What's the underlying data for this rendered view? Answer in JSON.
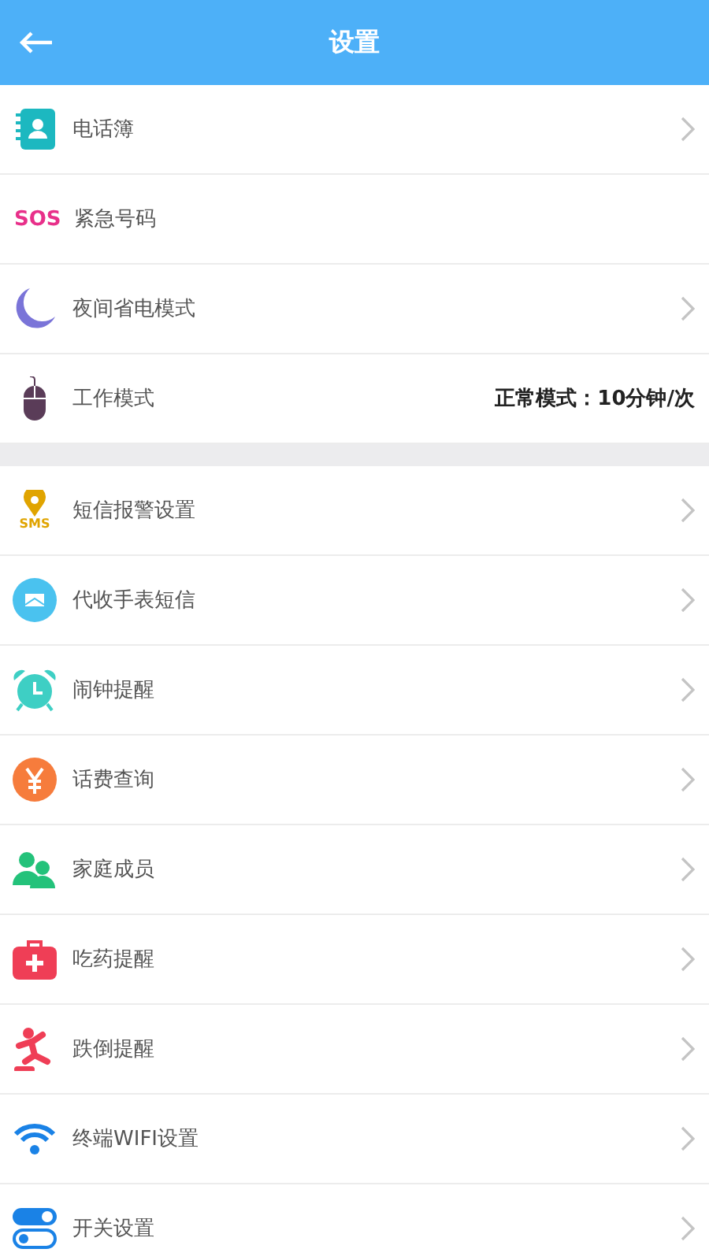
{
  "header": {
    "title": "设置"
  },
  "sections": [
    {
      "items": [
        {
          "label": "电话簿",
          "chevron": true
        },
        {
          "label": "紧急号码",
          "chevron": false,
          "icon_text": "SOS"
        },
        {
          "label": "夜间省电模式",
          "chevron": true
        },
        {
          "label": "工作模式",
          "chevron": false,
          "value": "正常模式：10分钟/次"
        }
      ]
    },
    {
      "items": [
        {
          "label": "短信报警设置",
          "chevron": true,
          "icon_text": "SMS"
        },
        {
          "label": "代收手表短信",
          "chevron": true
        },
        {
          "label": "闹钟提醒",
          "chevron": true
        },
        {
          "label": "话费查询",
          "chevron": true
        },
        {
          "label": "家庭成员",
          "chevron": true
        },
        {
          "label": "吃药提醒",
          "chevron": true
        },
        {
          "label": "跌倒提醒",
          "chevron": true
        },
        {
          "label": "终端WIFI设置",
          "chevron": true
        },
        {
          "label": "开关设置",
          "chevron": true
        }
      ]
    }
  ]
}
